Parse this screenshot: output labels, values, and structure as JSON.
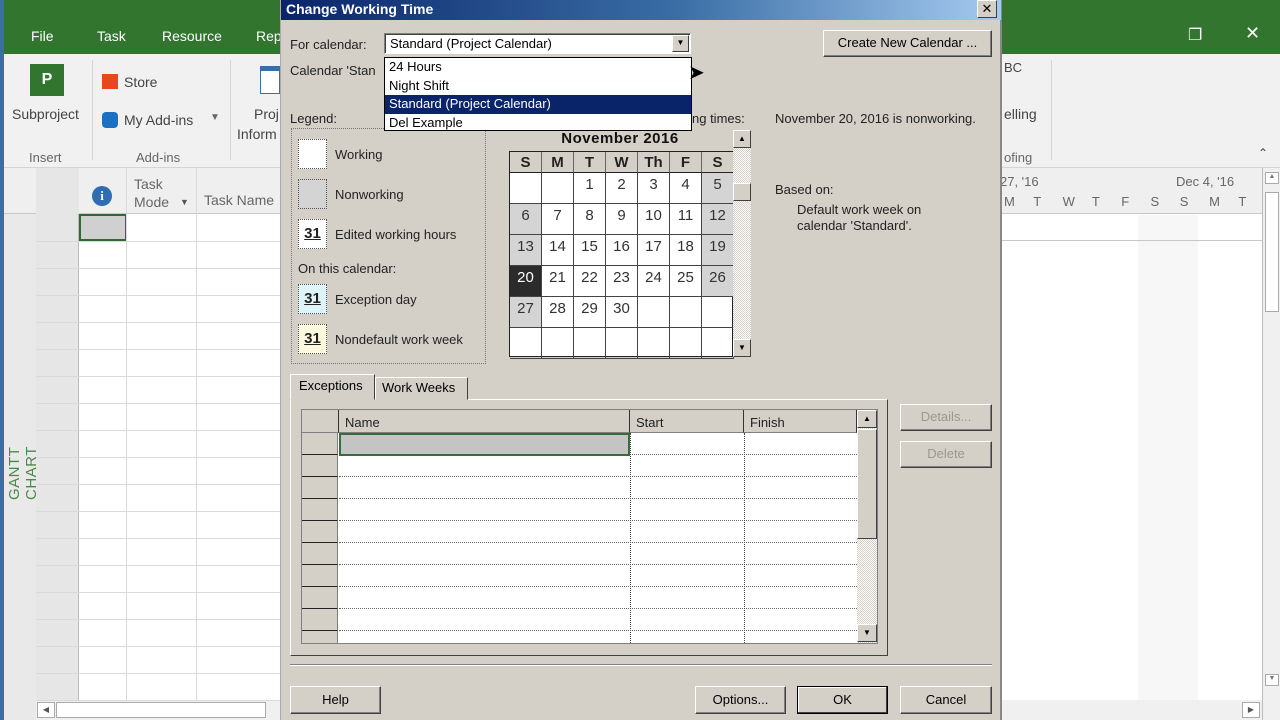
{
  "app": {
    "ribbon_tabs": [
      "File",
      "Task",
      "Resource",
      "Rep"
    ],
    "ribbon": {
      "subproject": "Subproject",
      "store": "Store",
      "my_addins": "My Add-ins",
      "project_info_1": "Proj",
      "project_info_2": "Inform",
      "spelling_top": "BC",
      "spelling": "elling",
      "group_insert": "Insert",
      "group_addins": "Add-ins",
      "group_proofing": "ofing"
    },
    "grid": {
      "info_header": "i",
      "task_mode_1": "Task",
      "task_mode_2": "Mode",
      "task_name": "Task Name"
    },
    "view_label": "GANTT CHART",
    "timescale": {
      "week1": "27, '16",
      "week2": "Dec 4, '16",
      "days": [
        "M",
        "T",
        "W",
        "T",
        "F",
        "S",
        "S",
        "M",
        "T"
      ]
    }
  },
  "dialog": {
    "title": "Change Working Time",
    "for_calendar_label": "For calendar:",
    "selected_calendar": "Standard (Project Calendar)",
    "calendar_options": [
      "24 Hours",
      "Night Shift",
      "Standard (Project Calendar)",
      "Del Example"
    ],
    "selected_option_index": 2,
    "calendar_info": "Calendar 'Stan",
    "create_new_calendar": "Create New Calendar ...",
    "legend_label": "Legend:",
    "click_label": "ng times:",
    "legend": {
      "working": "Working",
      "nonworking": "Nonworking",
      "edited": "Edited working hours",
      "on_this_calendar": "On this calendar:",
      "exception": "Exception day",
      "nondefault": "Nondefault work week",
      "swatch_number": "31"
    },
    "calendar": {
      "title": "November 2016",
      "weekdays": [
        "S",
        "M",
        "T",
        "W",
        "Th",
        "F",
        "S"
      ],
      "weeks": [
        [
          "",
          "",
          "1",
          "2",
          "3",
          "4",
          "5"
        ],
        [
          "6",
          "7",
          "8",
          "9",
          "10",
          "11",
          "12"
        ],
        [
          "13",
          "14",
          "15",
          "16",
          "17",
          "18",
          "19"
        ],
        [
          "20",
          "21",
          "22",
          "23",
          "24",
          "25",
          "26"
        ],
        [
          "27",
          "28",
          "29",
          "30",
          "",
          "",
          ""
        ],
        [
          "",
          "",
          "",
          "",
          "",
          "",
          ""
        ]
      ],
      "selected_day": "20"
    },
    "status": "November 20, 2016 is nonworking.",
    "based_on_label": "Based on:",
    "based_on_1": "Default work week on",
    "based_on_2": "calendar 'Standard'.",
    "tabs": [
      "Exceptions",
      "Work Weeks"
    ],
    "exceptions_columns": [
      "Name",
      "Start",
      "Finish"
    ],
    "details_button": "Details...",
    "delete_button": "Delete",
    "help_button": "Help",
    "options_button": "Options...",
    "ok_button": "OK",
    "cancel_button": "Cancel"
  }
}
